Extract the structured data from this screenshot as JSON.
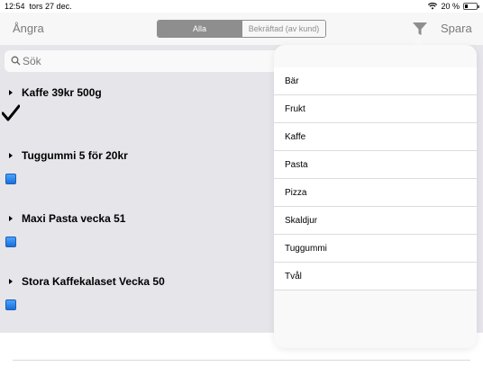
{
  "status_bar": {
    "time": "12:54",
    "date": "tors 27 dec.",
    "battery": "20 %"
  },
  "nav": {
    "undo_label": "Ångra",
    "save_label": "Spara",
    "segments": [
      "Alla",
      "Bekräftad (av kund)"
    ]
  },
  "search": {
    "placeholder": "Sök",
    "value": ""
  },
  "items": [
    {
      "title": "Kaffe 39kr 500g",
      "checked": true
    },
    {
      "title": "Tuggummi 5 för 20kr",
      "checked": false
    },
    {
      "title": "Maxi Pasta vecka 51",
      "checked": false
    },
    {
      "title": "Stora Kaffekalaset Vecka 50",
      "checked": false
    }
  ],
  "filter_menu": {
    "options": [
      "Bär",
      "Frukt",
      "Kaffe",
      "Pasta",
      "Pizza",
      "Skaldjur",
      "Tuggummi",
      "Tvål"
    ]
  },
  "colors": {
    "list_bg": "#e6e5ea",
    "checkbox_blue": "#1a6fd8",
    "nav_gray": "#8e8e8e"
  }
}
